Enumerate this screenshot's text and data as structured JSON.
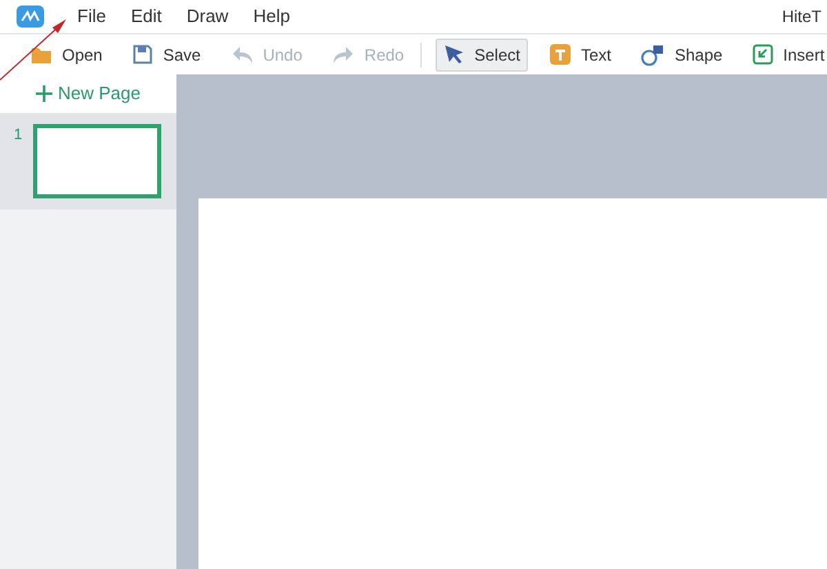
{
  "menu": [
    "File",
    "Edit",
    "Draw",
    "Help"
  ],
  "window": {
    "title": "HiteT"
  },
  "toolbar": [
    {
      "kind": "open",
      "label": "Open",
      "disabled": false,
      "selected": false
    },
    {
      "kind": "save",
      "label": "Save",
      "disabled": false,
      "selected": false
    },
    {
      "kind": "undo",
      "label": "Undo",
      "disabled": true,
      "selected": false
    },
    {
      "kind": "redo",
      "label": "Redo",
      "disabled": true,
      "selected": false
    },
    {
      "kind": "select",
      "label": "Select",
      "disabled": false,
      "selected": true
    },
    {
      "kind": "text",
      "label": "Text",
      "disabled": false,
      "selected": false
    },
    {
      "kind": "shape",
      "label": "Shape",
      "disabled": false,
      "selected": false
    },
    {
      "kind": "insert",
      "label": "Insert",
      "disabled": false,
      "selected": false
    }
  ],
  "sidebar": {
    "new_page": "New Page",
    "pages": [
      {
        "number": "1",
        "selected": true
      }
    ]
  }
}
